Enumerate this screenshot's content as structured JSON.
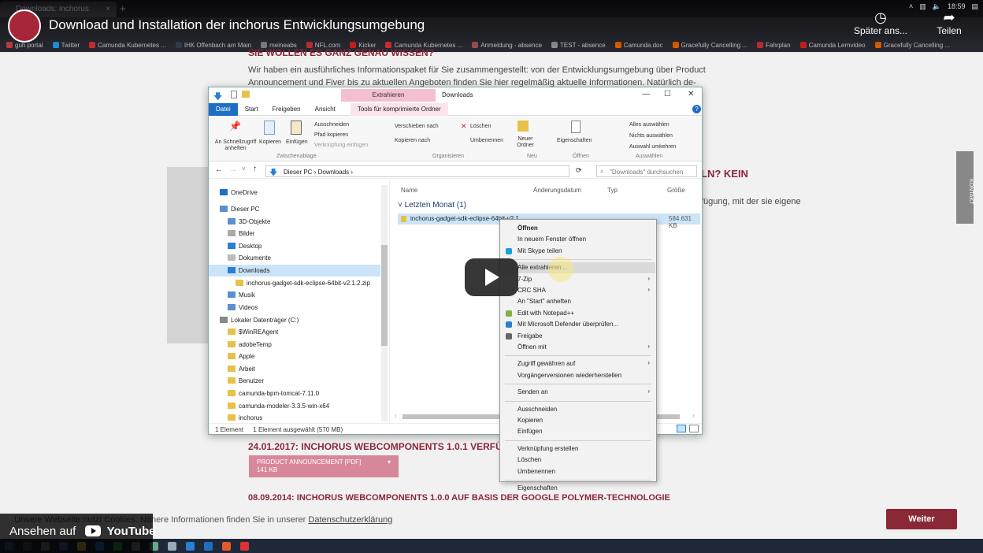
{
  "browser": {
    "tab_title": "Downloads: inchorus",
    "tab_close": "×",
    "new_tab": "+",
    "bookmarks": [
      {
        "label": "guh portal",
        "color": "#c44"
      },
      {
        "label": "Twitter",
        "color": "#1da1f2"
      },
      {
        "label": "Camunda Kubernetes ...",
        "color": "#d33"
      },
      {
        "label": "IHK Offenbach am Main",
        "color": "#345"
      },
      {
        "label": "meineabs",
        "color": "#888"
      },
      {
        "label": "NFL.com",
        "color": "#c33"
      },
      {
        "label": "Kicker",
        "color": "#d22"
      },
      {
        "label": "Camunda Kubernetes ...",
        "color": "#d33"
      },
      {
        "label": "Anmeldung - absence",
        "color": "#a55"
      },
      {
        "label": "TEST - absence",
        "color": "#999"
      },
      {
        "label": "Camunda.doc",
        "color": "#e60"
      },
      {
        "label": "Gracefully Cancelling ...",
        "color": "#e60"
      },
      {
        "label": "Fahrplan",
        "color": "#c33"
      },
      {
        "label": "Camunda Lernvideo",
        "color": "#d22"
      },
      {
        "label": "Gracefully Cancelling ...",
        "color": "#e60"
      }
    ]
  },
  "youtube": {
    "title": "Download und Installation der inchorus Entwicklungsumgebung",
    "watch_later": "Später ans...",
    "share": "Teilen",
    "watch_on": "Ansehen auf",
    "brand": "YouTube"
  },
  "page": {
    "heading_top": "SIE WOLLEN ES GANZ GENAU WISSEN?",
    "para_line1": "Wir haben ein ausführliches Informationspaket für Sie zusammengestellt: von der Entwicklungsumgebung über Product",
    "para_line2": "Announcement und Fiver bis zu aktuellen Angeboten finden Sie hier regelmäßig aktuelle Informationen. Natürlich de-",
    "heading_right": "LN? KEIN",
    "para_right": "fügung, mit der sie eigene",
    "heading_2017": "24.01.2017: INCHORUS WEBCOMPONENTS 1.0.1 VERFÜGB",
    "pdf_label": "PRODUCT ANNOUNCEMENT [PDF]",
    "pdf_size": "141 KB",
    "heading_2014": "08.09.2014: INCHORUS WEBCOMPONENTS 1.0.0 AUF BASIS DER GOOGLE POLYMER-TECHNOLOGIE",
    "kontakt": "KONTAKT",
    "cookie_text": "Unsere Webseite nutzt Cookies. Nähere Informationen finden Sie in unserer",
    "cookie_link": "Datenschutzerklärung",
    "weiter": "Weiter"
  },
  "explorer": {
    "extract_tab": "Extrahieren",
    "title": "Downloads",
    "tabs": [
      "Datei",
      "Start",
      "Freigeben",
      "Ansicht",
      "Tools für komprimierte Ordner"
    ],
    "ribbon": {
      "pin": "An Schnellzugriff anheften",
      "copy": "Kopieren",
      "paste": "Einfügen",
      "cut": "Ausschneiden",
      "copy_path": "Pfad kopieren",
      "paste_link": "Verknüpfung einfügen",
      "group_clipboard": "Zwischenablage",
      "move_to": "Verschieben nach",
      "copy_to": "Kopieren nach",
      "delete": "Löschen",
      "rename": "Umbenennen",
      "group_organize": "Organisieren",
      "new_folder": "Neuer Ordner",
      "group_new": "Neu",
      "properties": "Eigenschaften",
      "group_open": "Öffnen",
      "select_all": "Alles auswählen",
      "select_none": "Nichts auswählen",
      "invert": "Auswahl umkehren",
      "group_select": "Auswählen"
    },
    "address": [
      "Dieser PC",
      "Downloads"
    ],
    "search_placeholder": "\"Downloads\" durchsuchen",
    "nav": [
      {
        "label": "OneDrive",
        "indent": 1,
        "color": "#1e6fc4"
      },
      {
        "label": "Dieser PC",
        "indent": 1,
        "color": "#5a8fd0"
      },
      {
        "label": "3D-Objekte",
        "indent": 2,
        "color": "#5a8fd0"
      },
      {
        "label": "Bilder",
        "indent": 2,
        "color": "#aaa"
      },
      {
        "label": "Desktop",
        "indent": 2,
        "color": "#2a7fd4"
      },
      {
        "label": "Dokumente",
        "indent": 2,
        "color": "#bbb"
      },
      {
        "label": "Downloads",
        "indent": 2,
        "color": "#2a7fd4",
        "selected": true
      },
      {
        "label": "inchorus-gadget-sdk-eclipse-64bit-v2.1.2.zip",
        "indent": 3,
        "color": "#e7c24a"
      },
      {
        "label": "Musik",
        "indent": 2,
        "color": "#5a8fd0"
      },
      {
        "label": "Videos",
        "indent": 2,
        "color": "#5a8fd0"
      },
      {
        "label": "Lokaler Datenträger (C:)",
        "indent": 1,
        "color": "#888"
      },
      {
        "label": "$WinREAgent",
        "indent": 2,
        "color": "#e7c24a"
      },
      {
        "label": "adobeTemp",
        "indent": 2,
        "color": "#e7c24a"
      },
      {
        "label": "Apple",
        "indent": 2,
        "color": "#e7c24a"
      },
      {
        "label": "Arbeit",
        "indent": 2,
        "color": "#e7c24a"
      },
      {
        "label": "Benutzer",
        "indent": 2,
        "color": "#e7c24a"
      },
      {
        "label": "camunda-bpm-tomcat-7.11.0",
        "indent": 2,
        "color": "#e7c24a"
      },
      {
        "label": "camunda-modeler-3.3.5-win-x64",
        "indent": 2,
        "color": "#e7c24a"
      },
      {
        "label": "inchorus",
        "indent": 2,
        "color": "#e7c24a"
      }
    ],
    "columns": [
      "Name",
      "Änderungsdatum",
      "Typ",
      "Größe"
    ],
    "group": "Letzten Monat (1)",
    "file": {
      "name": "inchorus-gadget-sdk-eclipse-64bit-v2.1...",
      "size": "584.631 KB"
    },
    "status_count": "1 Element",
    "status_selected": "1 Element ausgewählt (570 MB)"
  },
  "context_menu": [
    {
      "label": "Öffnen",
      "bold": true
    },
    {
      "label": "In neuem Fenster öffnen"
    },
    {
      "label": "Mit Skype teilen",
      "icon": "#1ba0e0"
    },
    {
      "sep": true
    },
    {
      "label": "Alle extrahieren...",
      "highlight": true
    },
    {
      "label": "7-Zip",
      "arrow": true
    },
    {
      "label": "CRC SHA",
      "arrow": true
    },
    {
      "label": "An \"Start\" anheften"
    },
    {
      "label": "Edit with Notepad++",
      "icon": "#7cb342"
    },
    {
      "label": "Mit Microsoft Defender überprüfen...",
      "icon": "#2a7fd4"
    },
    {
      "label": "Freigabe",
      "icon": "#666"
    },
    {
      "label": "Öffnen mit",
      "arrow": true
    },
    {
      "sep": true
    },
    {
      "label": "Zugriff gewähren auf",
      "arrow": true
    },
    {
      "label": "Vorgängerversionen wiederherstellen"
    },
    {
      "sep": true
    },
    {
      "label": "Senden an",
      "arrow": true
    },
    {
      "sep": true
    },
    {
      "label": "Ausschneiden"
    },
    {
      "label": "Kopieren"
    },
    {
      "label": "Einfügen"
    },
    {
      "sep": true
    },
    {
      "label": "Verknüpfung erstellen"
    },
    {
      "label": "Löschen"
    },
    {
      "label": "Umbenennen"
    },
    {
      "sep": true
    },
    {
      "label": "Eigenschaften"
    }
  ],
  "taskbar": {
    "time": "18:59"
  }
}
